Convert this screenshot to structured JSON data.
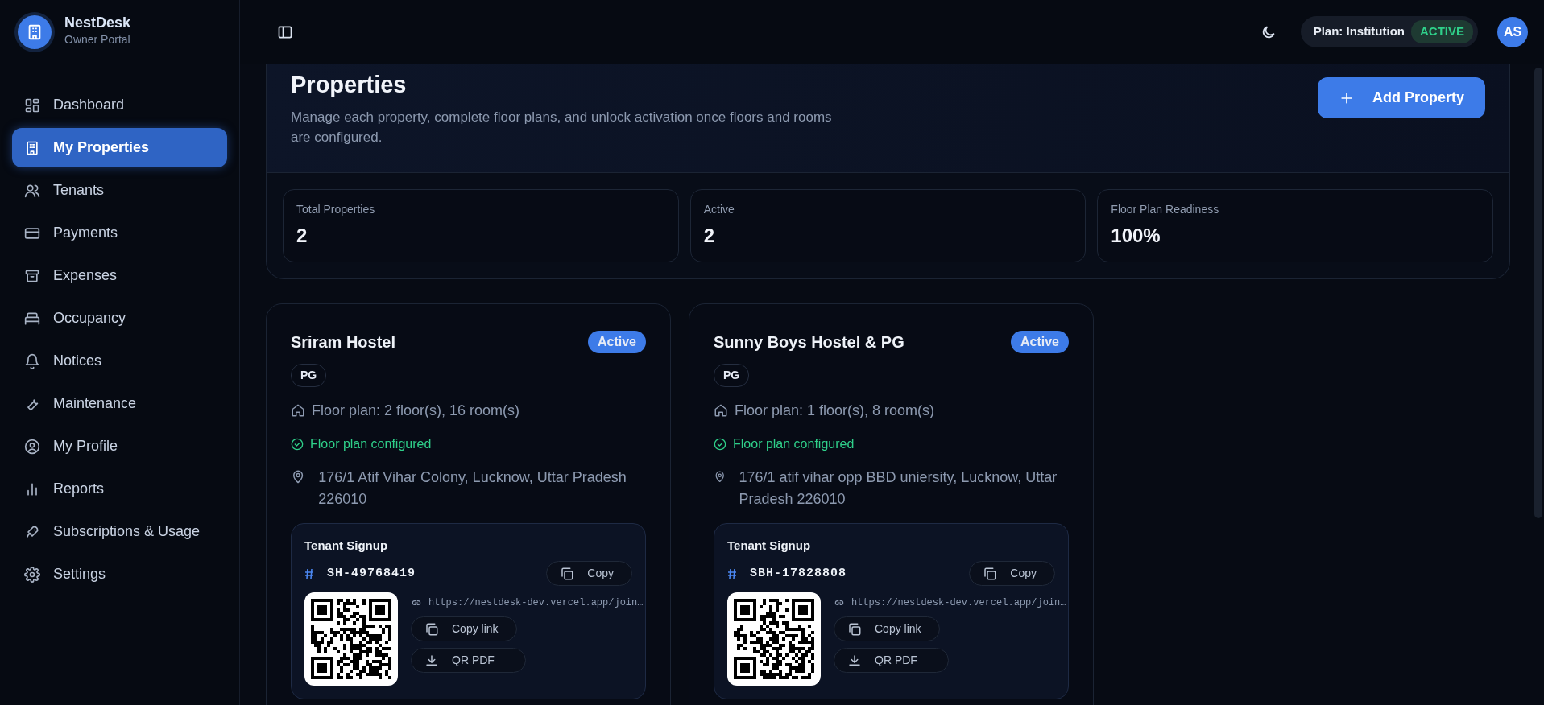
{
  "brand": {
    "name": "NestDesk",
    "subtitle": "Owner Portal"
  },
  "nav": [
    {
      "label": "Dashboard",
      "selected": false
    },
    {
      "label": "My Properties",
      "selected": true
    },
    {
      "label": "Tenants",
      "selected": false
    },
    {
      "label": "Payments",
      "selected": false
    },
    {
      "label": "Expenses",
      "selected": false
    },
    {
      "label": "Occupancy",
      "selected": false
    },
    {
      "label": "Notices",
      "selected": false
    },
    {
      "label": "Maintenance",
      "selected": false
    },
    {
      "label": "My Profile",
      "selected": false
    },
    {
      "label": "Reports",
      "selected": false
    },
    {
      "label": "Subscriptions & Usage",
      "selected": false
    },
    {
      "label": "Settings",
      "selected": false
    }
  ],
  "header": {
    "plan_label": "Plan: Institution",
    "plan_status": "ACTIVE",
    "avatar": "AS"
  },
  "page": {
    "title": "Properties",
    "description": "Manage each property, complete floor plans, and unlock activation once floors and rooms are configured.",
    "add_button": "Add Property"
  },
  "stats": [
    {
      "label": "Total Properties",
      "value": "2"
    },
    {
      "label": "Active",
      "value": "2"
    },
    {
      "label": "Floor Plan Readiness",
      "value": "100%"
    }
  ],
  "properties": [
    {
      "name": "Sriram Hostel",
      "status": "Active",
      "type": "PG",
      "floor_plan": "Floor plan: 2 floor(s), 16 room(s)",
      "floor_status": "Floor plan configured",
      "configured": true,
      "address": "176/1 Atif Vihar Colony, Lucknow, Uttar Pradesh 226010",
      "signup": {
        "title": "Tenant Signup",
        "code": "SH-49768419",
        "copy": "Copy",
        "link": "https://nestdesk-dev.vercel.app/join…",
        "copy_link": "Copy link",
        "pdf": "QR PDF"
      }
    },
    {
      "name": "Sunny Boys Hostel & PG",
      "status": "Active",
      "type": "PG",
      "floor_plan": "Floor plan: 1 floor(s), 8 room(s)",
      "floor_status": "Floor plan configured",
      "configured": true,
      "address": "176/1 atif vihar opp BBD uniersity, Lucknow, Uttar Pradesh 226010",
      "signup": {
        "title": "Tenant Signup",
        "code": "SBH-17828808",
        "copy": "Copy",
        "link": "https://nestdesk-dev.vercel.app/join…",
        "copy_link": "Copy link",
        "pdf": "QR PDF"
      }
    }
  ]
}
